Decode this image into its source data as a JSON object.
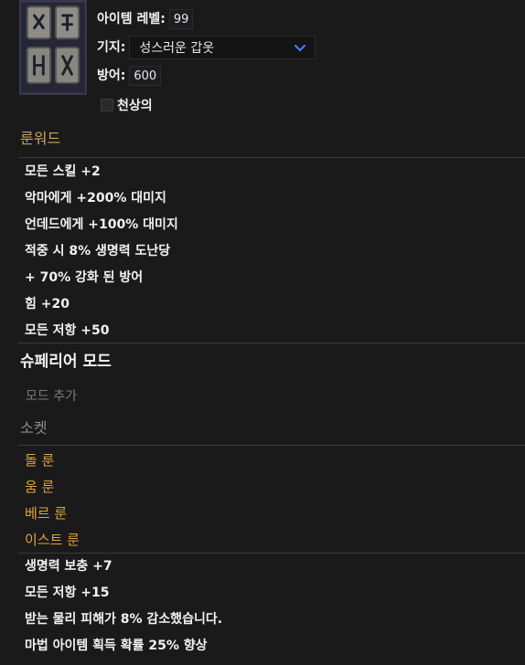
{
  "header": {
    "item_level_label": "아이템 레벨:",
    "item_level_value": "99",
    "base_label": "기지:",
    "base_selected": "성스러운 갑옷",
    "defense_label": "방어:",
    "defense_value": "600",
    "ethereal_label": "천상의"
  },
  "runeword": {
    "title": "룬워드",
    "mods": [
      "모든 스킬 +2",
      "악마에게 +200% 대미지",
      "언데드에게 +100% 대미지",
      "적중 시 8% 생명력 도난당",
      "+ 70% 강화 된 방어",
      "힘 +20",
      "모든 저항 +50"
    ]
  },
  "superior": {
    "title": "슈페리어 모드",
    "add_mod_placeholder": "모드 추가"
  },
  "sockets": {
    "title": "소켓",
    "runes": [
      "돌 룬",
      "움 룬",
      "베르 룬",
      "이스트 룬"
    ],
    "mods": [
      "생명력 보충 +7",
      "모든 저항 +15",
      "받는 물리 피해가 8% 감소했습니다.",
      "마법 아이템 획득 확률 25% 향상"
    ]
  },
  "colors": {
    "accent_gold": "#cfa15c",
    "rune_orange": "#e2a43a",
    "muted": "#7b7b7b",
    "chevron_blue": "#3b82f6"
  },
  "icons": {
    "item": "armor-runes-icon",
    "chevron": "chevron-down-icon"
  }
}
